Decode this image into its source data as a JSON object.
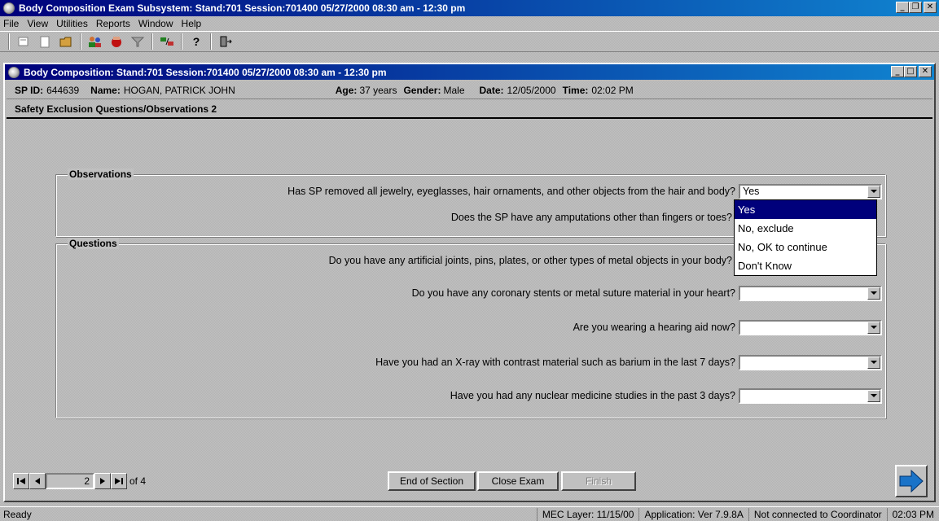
{
  "app": {
    "title": "Body Composition Exam Subsystem: Stand:701 Session:701400 05/27/2000 08:30 am - 12:30 pm"
  },
  "menu": [
    "File",
    "View",
    "Utilities",
    "Reports",
    "Window",
    "Help"
  ],
  "toolbar_icons": [
    "edit-icon",
    "clipboard-icon",
    "folder-icon",
    "people-icon",
    "stop-hand-icon",
    "funnel-icon",
    "swap-icon",
    "help-icon",
    "exit-door-icon"
  ],
  "child": {
    "title": "Body Composition: Stand:701 Session:701400 05/27/2000 08:30 am - 12:30 pm",
    "sp_id_label": "SP ID:",
    "sp_id": "644639",
    "name_label": "Name:",
    "name": "HOGAN, PATRICK JOHN",
    "age_label": "Age:",
    "age": "37 years",
    "gender_label": "Gender:",
    "gender": "Male",
    "date_label": "Date:",
    "date": "12/05/2000",
    "time_label": "Time:",
    "time": "02:02 PM",
    "section_title": "Safety Exclusion Questions/Observations 2"
  },
  "observations": {
    "label": "Observations",
    "items": [
      {
        "text": "Has SP removed all jewelry, eyeglasses, hair ornaments, and other objects from the hair and body?",
        "value": "Yes"
      },
      {
        "text": "Does the SP have any amputations other than fingers or toes?",
        "value": ""
      }
    ]
  },
  "questions": {
    "label": "Questions",
    "items": [
      {
        "text": "Do you have any artificial joints, pins, plates, or other types of metal objects in your body?",
        "value": ""
      },
      {
        "text": "Do you have any coronary stents or metal suture material in your heart?",
        "value": ""
      },
      {
        "text": "Are you wearing a hearing aid now?",
        "value": ""
      },
      {
        "text": "Have you had an X-ray with contrast material such as barium in the last 7 days?",
        "value": ""
      },
      {
        "text": "Have you had any nuclear medicine studies in the past 3 days?",
        "value": ""
      }
    ]
  },
  "dropdown_options": [
    "Yes",
    "No, exclude",
    "No, OK to continue",
    "Don't Know"
  ],
  "nav": {
    "page": "2",
    "of": "of 4"
  },
  "buttons": {
    "end_section": "End of Section",
    "close_exam": "Close Exam",
    "finish": "Finish"
  },
  "status": {
    "ready": "Ready",
    "layer": "MEC Layer: 11/15/00",
    "app_version": "Application: Ver 7.9.8A",
    "connection": "Not connected to Coordinator",
    "time": "02:03 PM"
  },
  "colors": {
    "titlebar": "#00007b",
    "selection": "#00007b",
    "next_arrow": "#1a73c8"
  }
}
